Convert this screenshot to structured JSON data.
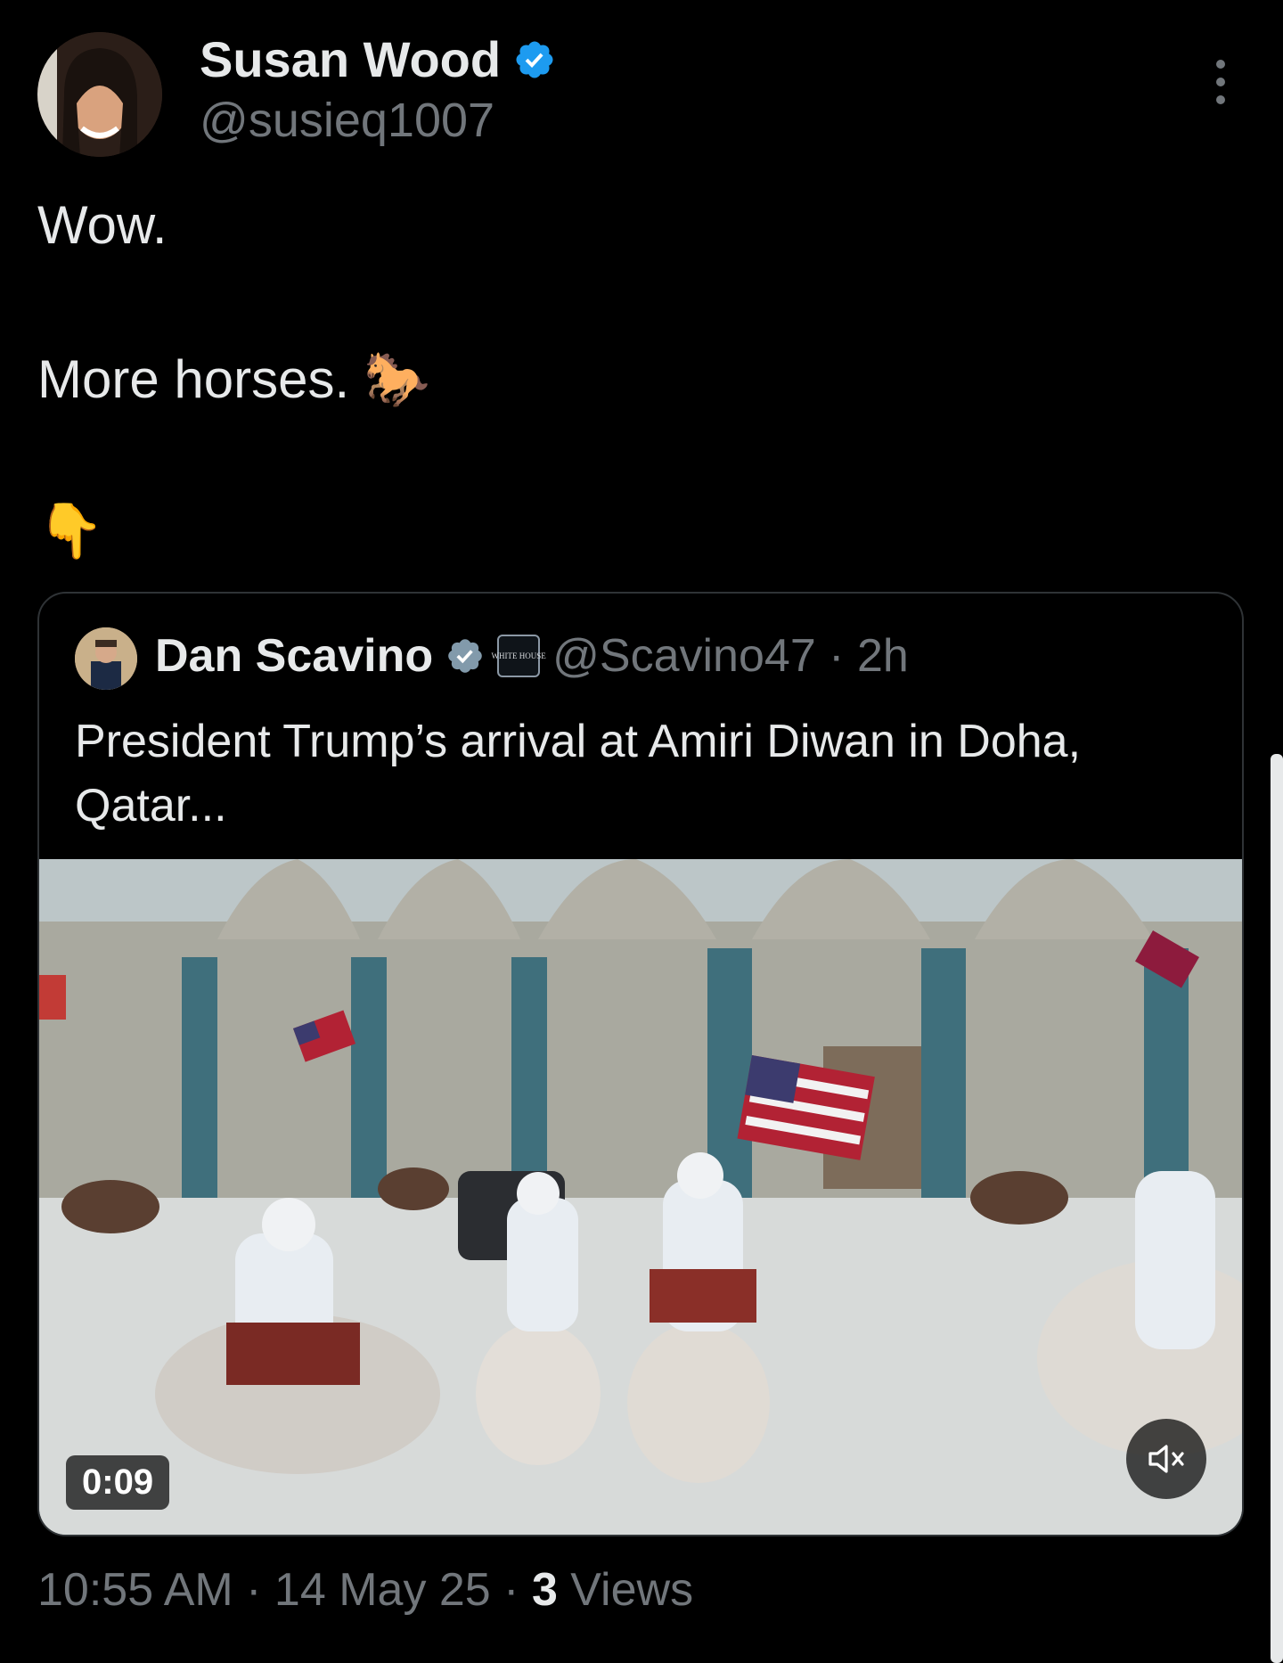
{
  "tweet": {
    "author_name": "Susan Wood",
    "author_handle": "@susieq1007",
    "line1": "Wow.",
    "line2": "More horses.",
    "line2_emoji": "🐎",
    "line3_emoji": "👇",
    "timestamp": "10:55 AM · 14 May 25 · ",
    "views_count": "3",
    "views_label": " Views"
  },
  "quoted_tweet": {
    "author_name": "Dan Scavino",
    "affiliation_badge": "WHITE HOUSE",
    "author_handle": "@Scavino47 · 2h",
    "text": "President Trump’s arrival at Amiri Diwan in Doha, Qatar...",
    "video_duration": "0:09"
  },
  "icons": {
    "verified": "verified-badge-icon",
    "more": "more-options-icon",
    "mute": "speaker-muted-icon"
  },
  "colors": {
    "background": "#000000",
    "text": "#e7e9ea",
    "muted": "#71767b",
    "verified": "#1d9bf0",
    "border": "#2f3336"
  }
}
